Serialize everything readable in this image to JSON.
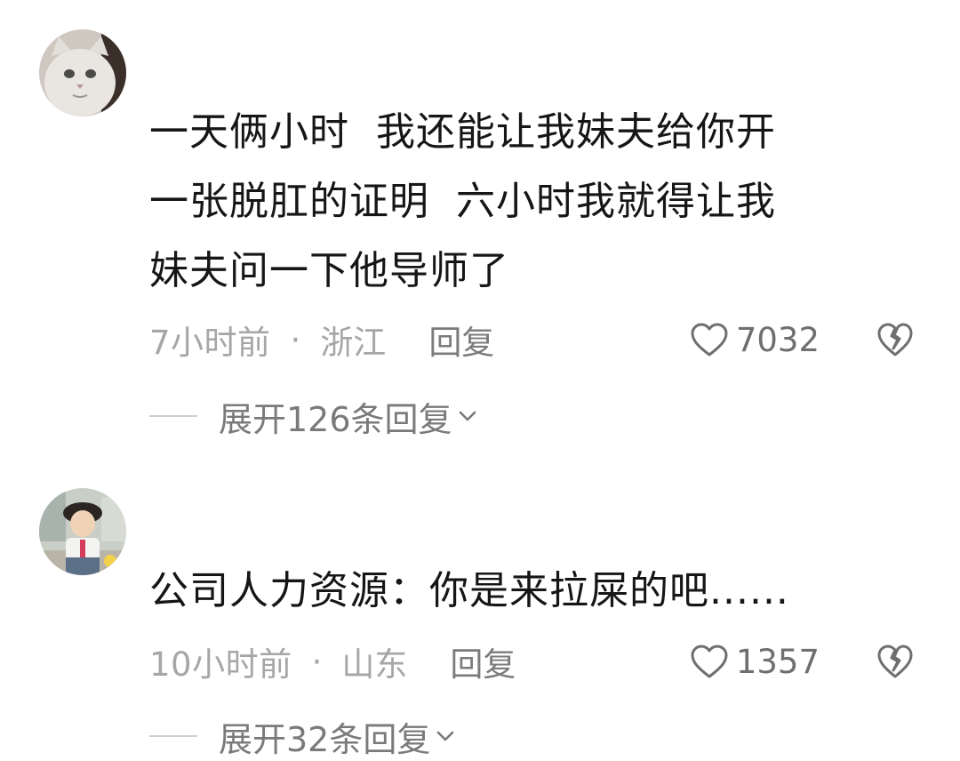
{
  "comments": [
    {
      "avatar": "cat-avatar",
      "text": "一天俩小时  我还能让我妹夫给你开\n一张脱肛的证明  六小时我就得让我\n妹夫问一下他导师了",
      "time": "7小时前",
      "separator": "·",
      "location": "浙江",
      "reply_label": "回复",
      "likes": "7032",
      "expand_label": "展开126条回复"
    },
    {
      "avatar": "child-avatar",
      "text": "公司人力资源：你是来拉屎的吧......",
      "time": "10小时前",
      "separator": "·",
      "location": "山东",
      "reply_label": "回复",
      "likes": "1357",
      "expand_label": "展开32条回复"
    }
  ],
  "colors": {
    "text": "#161616",
    "meta": "#a6a6a6",
    "action": "#7b7b7b"
  },
  "icons": {
    "like": "heart-outline-icon",
    "dislike": "broken-heart-icon",
    "expand": "chevron-down-icon"
  }
}
